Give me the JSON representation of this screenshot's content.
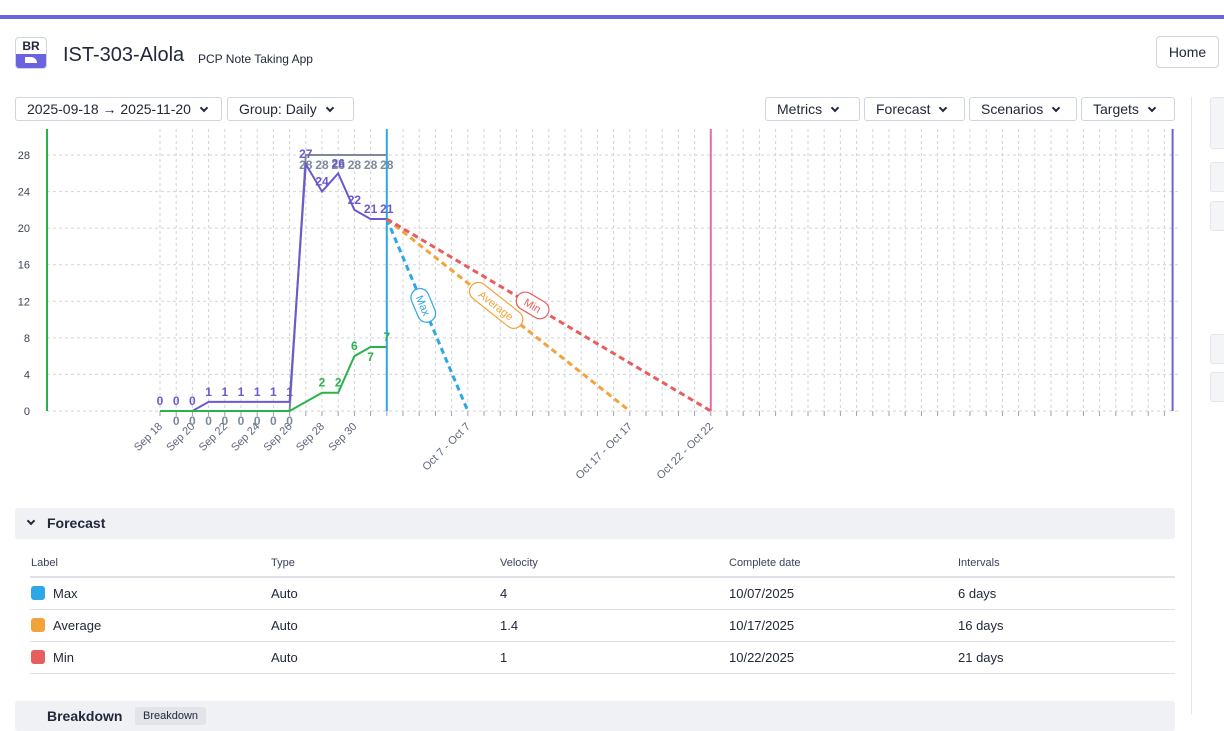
{
  "header": {
    "logo_text": "BR",
    "title": "IST-303-Alola",
    "subtitle": "PCP Note Taking App",
    "home_label": "Home"
  },
  "toolbar": {
    "date_range": "2025-09-18 → 2025-11-20",
    "group": "Group: Daily",
    "metrics": "Metrics",
    "forecast": "Forecast",
    "scenarios": "Scenarios",
    "targets": "Targets"
  },
  "colors": {
    "accent": "#6a63e0",
    "completed": "#6a5acd",
    "total": "#7c8a99",
    "done_green": "#2bb24c",
    "max": "#2ea7e6",
    "average": "#f3a33a",
    "min": "#e85d5d",
    "today_line": "#2ea7e6",
    "pink_marker": "#e86aa9",
    "end_marker": "#6a63e0",
    "start_marker": "#2bb24c"
  },
  "chart_data": {
    "type": "line",
    "x_start": "2025-09-18",
    "x_end": "2025-11-20",
    "ylim": [
      0,
      28
    ],
    "y_ticks": [
      0,
      4,
      8,
      12,
      16,
      20,
      24,
      28
    ],
    "grid": true,
    "x_tick_labels": [
      "Sep 18",
      "Sep 20",
      "Sep 22",
      "Sep 24",
      "Sep 26",
      "Sep 28",
      "Sep 30",
      "Oct 7 - Oct 7",
      "Oct 17 - Oct 17",
      "Oct 22 - Oct 22"
    ],
    "series": [
      {
        "key": "total",
        "x": [
          "2025-09-18",
          "2025-09-19",
          "2025-09-20",
          "2025-09-21",
          "2025-09-22",
          "2025-09-23",
          "2025-09-24",
          "2025-09-25",
          "2025-09-26",
          "2025-09-27",
          "2025-09-28",
          "2025-09-29",
          "2025-09-30",
          "2025-10-01",
          "2025-10-02"
        ],
        "values": [
          0,
          0,
          0,
          0,
          0,
          0,
          0,
          0,
          0,
          28,
          28,
          28,
          28,
          28,
          28
        ],
        "labels": [
          "",
          "0",
          "0",
          "0",
          "0",
          "0",
          "0",
          "0",
          "0",
          "28",
          "28",
          "28",
          "28",
          "28",
          "28"
        ]
      },
      {
        "key": "remaining",
        "x": [
          "2025-09-18",
          "2025-09-19",
          "2025-09-20",
          "2025-09-21",
          "2025-09-22",
          "2025-09-23",
          "2025-09-24",
          "2025-09-25",
          "2025-09-26",
          "2025-09-27",
          "2025-09-28",
          "2025-09-29",
          "2025-09-30",
          "2025-10-01",
          "2025-10-02"
        ],
        "values": [
          0,
          0,
          0,
          1,
          1,
          1,
          1,
          1,
          1,
          27,
          24,
          26,
          22,
          21,
          21
        ],
        "labels": [
          "0",
          "0",
          "0",
          "1",
          "1",
          "1",
          "1",
          "1",
          "1",
          "27",
          "24",
          "26",
          "22",
          "21",
          "21"
        ]
      },
      {
        "key": "completed",
        "x": [
          "2025-09-18",
          "2025-09-19",
          "2025-09-20",
          "2025-09-21",
          "2025-09-22",
          "2025-09-23",
          "2025-09-24",
          "2025-09-25",
          "2025-09-26",
          "2025-09-27",
          "2025-09-28",
          "2025-09-29",
          "2025-09-30",
          "2025-10-01",
          "2025-10-02"
        ],
        "values": [
          0,
          0,
          0,
          0,
          0,
          0,
          0,
          0,
          0,
          1,
          2,
          2,
          6,
          7,
          7
        ],
        "labels": [
          "",
          "",
          "",
          "",
          "",
          "",
          "",
          "",
          "",
          "",
          "2",
          "2",
          "6",
          "7",
          "7"
        ]
      }
    ],
    "forecasts": [
      {
        "name": "Max",
        "from": [
          "2025-10-02",
          21
        ],
        "to": [
          "2025-10-07",
          0
        ]
      },
      {
        "name": "Average",
        "from": [
          "2025-10-02",
          21
        ],
        "to": [
          "2025-10-17",
          0
        ]
      },
      {
        "name": "Min",
        "from": [
          "2025-10-02",
          21
        ],
        "to": [
          "2025-10-22",
          0
        ]
      }
    ],
    "markers": [
      {
        "key": "start",
        "x": "2025-09-18"
      },
      {
        "key": "today",
        "x": "2025-10-02"
      },
      {
        "key": "min_end",
        "x": "2025-10-22"
      },
      {
        "key": "end",
        "x": "2025-11-20"
      }
    ]
  },
  "forecast_section": {
    "title": "Forecast",
    "columns": [
      "Label",
      "Type",
      "Velocity",
      "Complete date",
      "Intervals"
    ],
    "rows": [
      {
        "label": "Max",
        "type": "Auto",
        "velocity": "4",
        "date": "10/07/2025",
        "intervals": "6 days",
        "color": "#2ea7e6"
      },
      {
        "label": "Average",
        "type": "Auto",
        "velocity": "1.4",
        "date": "10/17/2025",
        "intervals": "16 days",
        "color": "#f3a33a"
      },
      {
        "label": "Min",
        "type": "Auto",
        "velocity": "1",
        "date": "10/22/2025",
        "intervals": "21 days",
        "color": "#e85d5d"
      }
    ]
  },
  "breakdown_section": {
    "title": "Breakdown",
    "chip": "Breakdown"
  }
}
